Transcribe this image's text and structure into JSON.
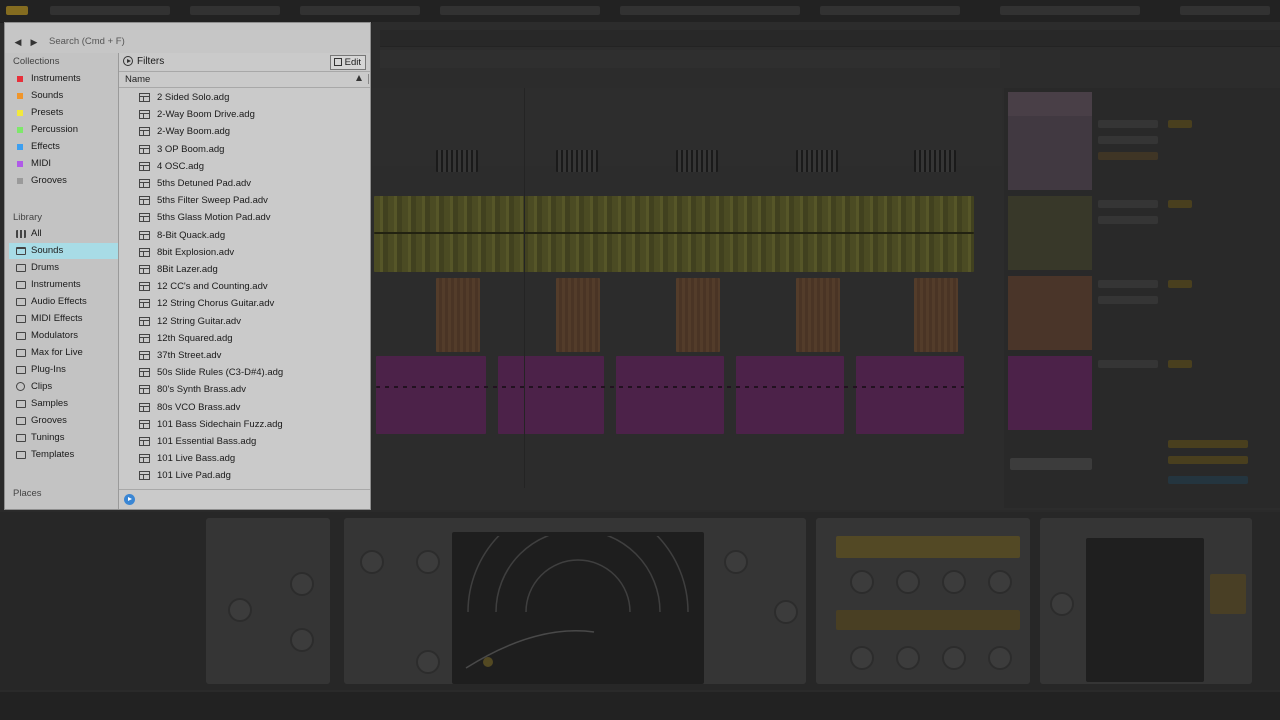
{
  "search": {
    "placeholder": "Search (Cmd + F)"
  },
  "sidebar": {
    "collections_title": "Collections",
    "collections": [
      {
        "label": "Instruments",
        "color": "#e8303a"
      },
      {
        "label": "Sounds",
        "color": "#f0952a"
      },
      {
        "label": "Presets",
        "color": "#f2e93c"
      },
      {
        "label": "Percussion",
        "color": "#7ee86a"
      },
      {
        "label": "Effects",
        "color": "#3c9ff0"
      },
      {
        "label": "MIDI",
        "color": "#b05ae8"
      },
      {
        "label": "Grooves",
        "color": "#9a9a9a"
      }
    ],
    "library_title": "Library",
    "library": [
      {
        "label": "All",
        "icon": "all-icon"
      },
      {
        "label": "Sounds",
        "icon": "sounds-icon"
      },
      {
        "label": "Drums",
        "icon": "drums-icon"
      },
      {
        "label": "Instruments",
        "icon": "instruments-icon"
      },
      {
        "label": "Audio Effects",
        "icon": "audio-effects-icon"
      },
      {
        "label": "MIDI Effects",
        "icon": "midi-effects-icon"
      },
      {
        "label": "Modulators",
        "icon": "modulators-icon"
      },
      {
        "label": "Max for Live",
        "icon": "max-for-live-icon"
      },
      {
        "label": "Plug-Ins",
        "icon": "plug-ins-icon"
      },
      {
        "label": "Clips",
        "icon": "clips-icon"
      },
      {
        "label": "Samples",
        "icon": "samples-icon"
      },
      {
        "label": "Grooves",
        "icon": "grooves-icon"
      },
      {
        "label": "Tunings",
        "icon": "tunings-icon"
      },
      {
        "label": "Templates",
        "icon": "templates-icon"
      }
    ],
    "selected_library": "Sounds",
    "places_title": "Places"
  },
  "content": {
    "filters_label": "Filters",
    "edit_label": "Edit",
    "column_name": "Name",
    "files": [
      "2 Sided Solo.adg",
      "2-Way Boom Drive.adg",
      "2-Way Boom.adg",
      "3 OP Boom.adg",
      "4 OSC.adg",
      "5ths Detuned Pad.adv",
      "5ths Filter Sweep Pad.adv",
      "5ths Glass Motion Pad.adv",
      "8-Bit Quack.adg",
      "8bit Explosion.adv",
      "8Bit Lazer.adg",
      "12 CC's and Counting.adv",
      "12 String Chorus Guitar.adv",
      "12 String Guitar.adv",
      "12th Squared.adg",
      "37th Street.adv",
      "50s Slide Rules (C3-D#4).adg",
      "80's Synth Brass.adv",
      "80s VCO Brass.adv",
      "101 Bass Sidechain Fuzz.adg",
      "101 Essential Bass.adg",
      "101 Live Bass.adg",
      "101 Live Pad.adg"
    ]
  },
  "colors": {
    "selection": "#a8dce6",
    "preview": "#3a86d4"
  }
}
